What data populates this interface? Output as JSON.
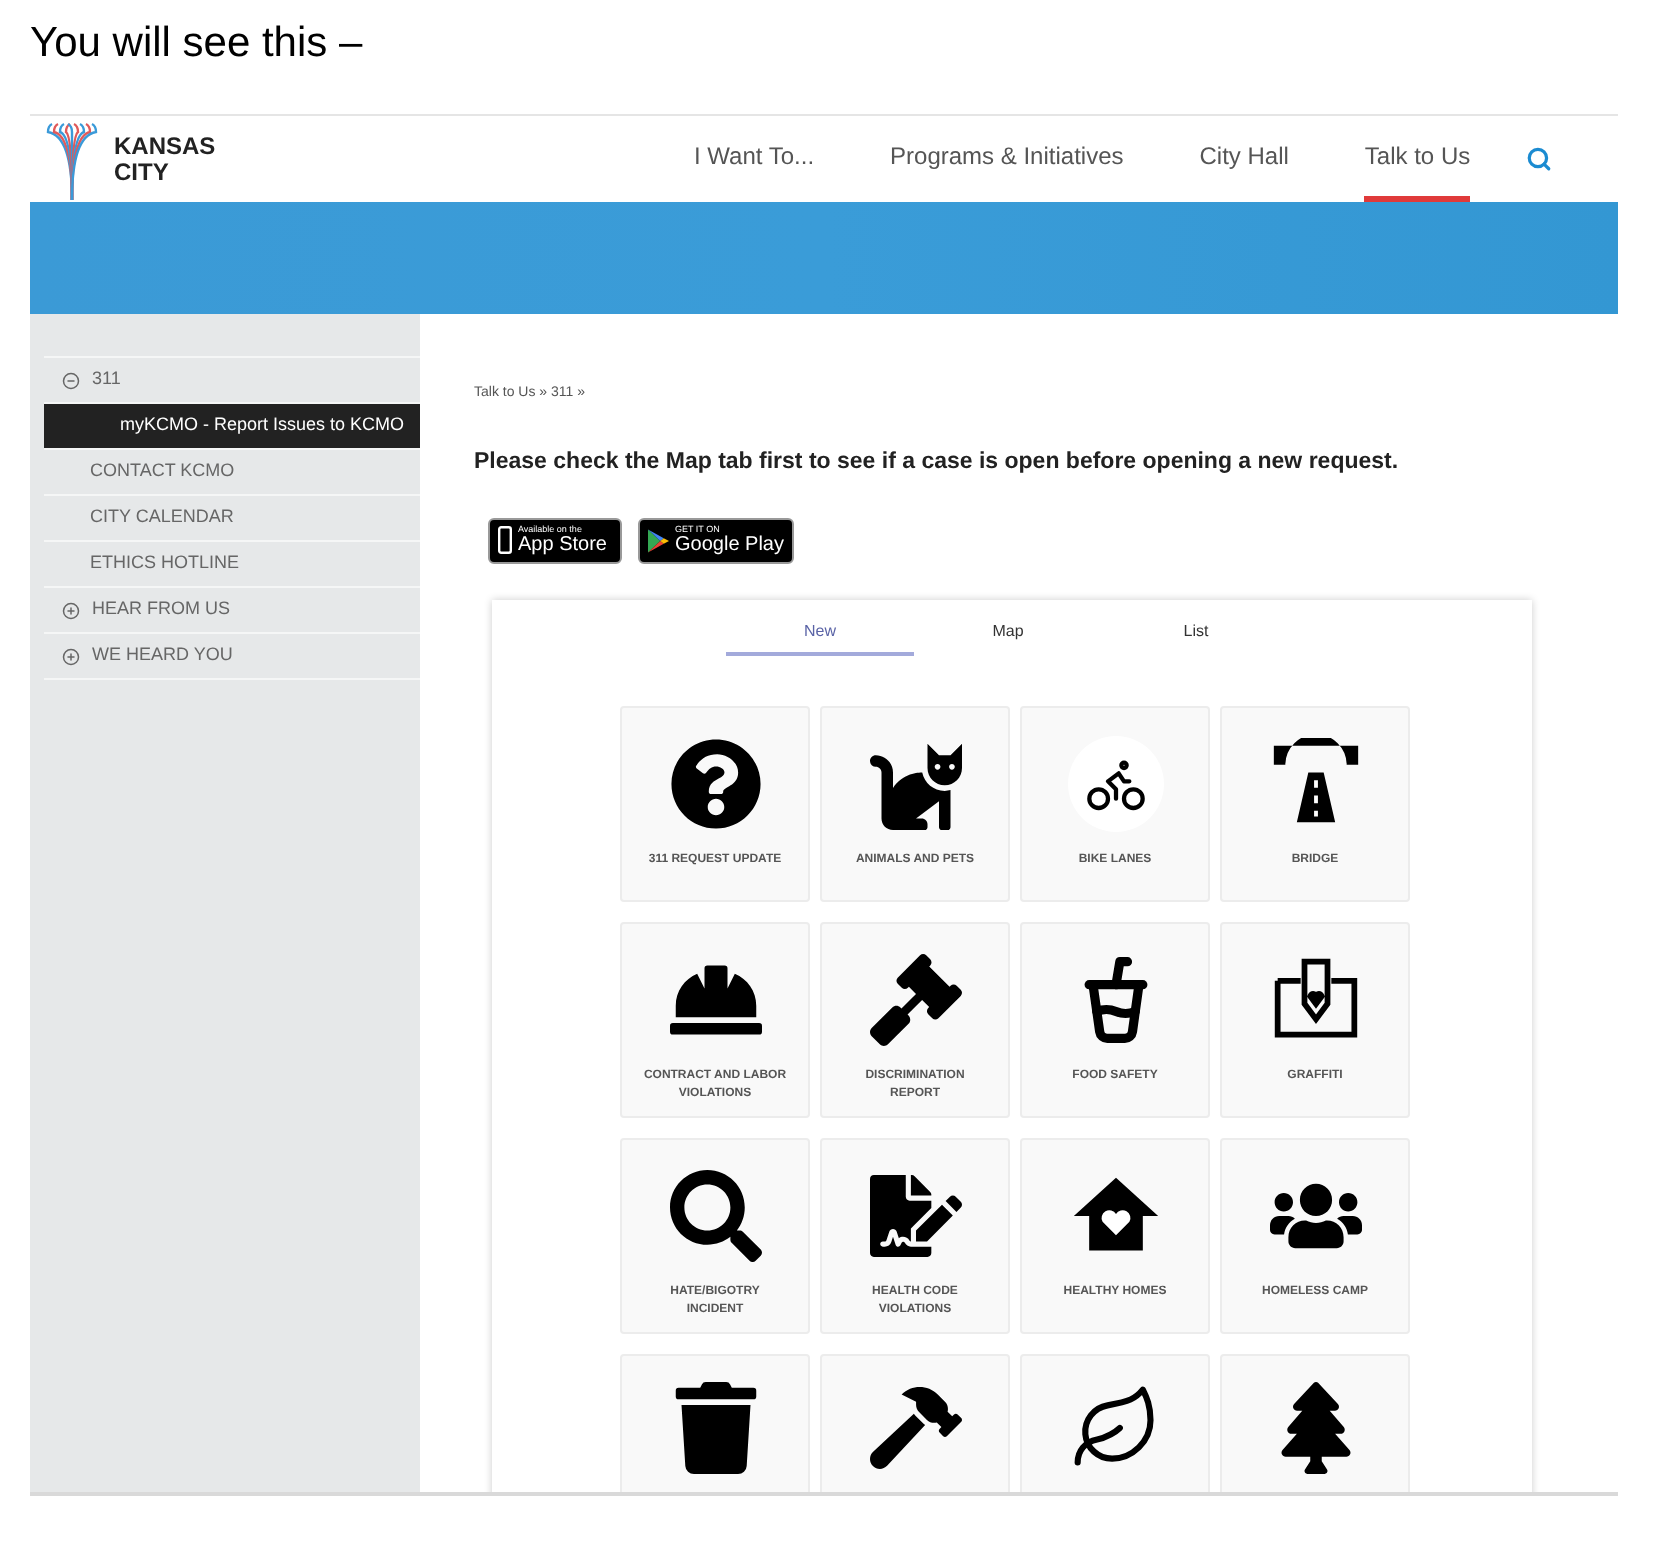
{
  "caption": "You will see this –",
  "logo": {
    "text": "KANSAS CITY"
  },
  "nav": [
    {
      "label": "I Want To...",
      "selected": false
    },
    {
      "label": "Programs & Initiatives",
      "selected": false
    },
    {
      "label": "City Hall",
      "selected": false
    },
    {
      "label": "Talk to Us",
      "selected": true
    }
  ],
  "sidebar": {
    "items": [
      {
        "label": "311",
        "expanded": true,
        "selected": false,
        "children": [
          {
            "label": "myKCMO - Report Issues to KCMO",
            "selected": true
          },
          {
            "label": "CONTACT KCMO",
            "selected": false
          },
          {
            "label": "CITY CALENDAR",
            "selected": false
          },
          {
            "label": "ETHICS HOTLINE",
            "selected": false
          }
        ]
      },
      {
        "label": "HEAR FROM US",
        "expanded": false,
        "selected": false
      },
      {
        "label": "WE HEARD YOU",
        "expanded": false,
        "selected": false
      }
    ]
  },
  "breadcrumb": "Talk to Us » 311 »",
  "notice": "Please check the Map tab first to see if a case is open before opening a new request.",
  "store_badges": [
    {
      "kind": "apple",
      "small": "Available on the",
      "big": "App Store"
    },
    {
      "kind": "google",
      "small": "GET IT ON",
      "big": "Google Play"
    }
  ],
  "tabs": [
    {
      "label": "New",
      "selected": true
    },
    {
      "label": "Map",
      "selected": false
    },
    {
      "label": "List",
      "selected": false
    }
  ],
  "tiles": [
    {
      "label": "311 REQUEST UPDATE",
      "cut": false
    },
    {
      "label": "ANIMALS AND PETS",
      "cut": false
    },
    {
      "label": "BIKE LANES",
      "cut": false
    },
    {
      "label": "BRIDGE",
      "cut": false
    },
    {
      "label": "CONTRACT AND LABOR VIOLATIONS",
      "cut": false
    },
    {
      "label": "DISCRIMINATION REPORT",
      "cut": false
    },
    {
      "label": "FOOD SAFETY",
      "cut": false
    },
    {
      "label": "GRAFFITI",
      "cut": false
    },
    {
      "label": "HATE/BIGOTRY INCIDENT",
      "cut": false
    },
    {
      "label": "HEALTH CODE VIOLATIONS",
      "cut": false
    },
    {
      "label": "HEALTHY HOMES",
      "cut": false
    },
    {
      "label": "HOMELESS CAMP",
      "cut": false
    },
    {
      "cut": true
    },
    {
      "cut": true
    },
    {
      "cut": true
    },
    {
      "cut": true
    }
  ]
}
